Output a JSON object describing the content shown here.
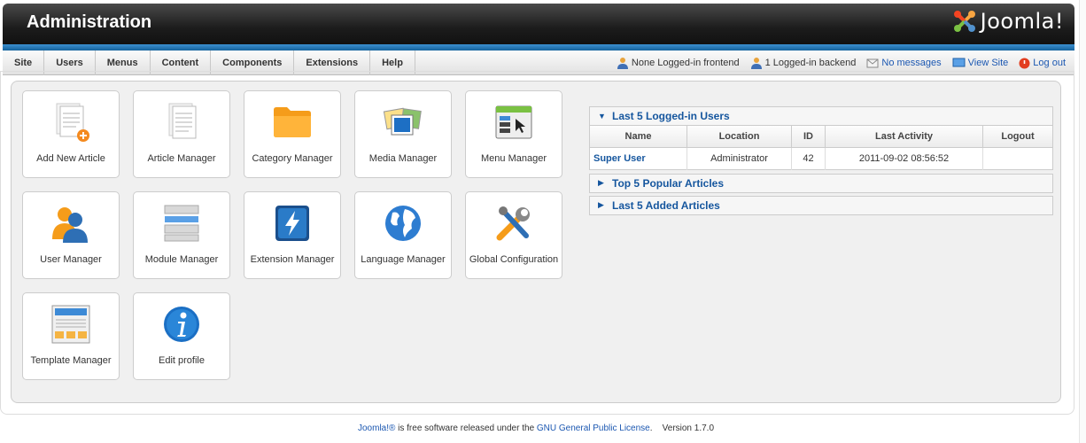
{
  "header": {
    "title": "Administration",
    "logo_text": "Joomla!"
  },
  "menu": [
    "Site",
    "Users",
    "Menus",
    "Content",
    "Components",
    "Extensions",
    "Help"
  ],
  "status": {
    "frontend": "None Logged-in frontend",
    "backend": "1 Logged-in backend",
    "messages": "No messages",
    "view_site": "View Site",
    "logout": "Log out"
  },
  "quickicons": [
    {
      "label": "Add New Article",
      "icon": "add-article-icon"
    },
    {
      "label": "Article Manager",
      "icon": "article-icon"
    },
    {
      "label": "Category Manager",
      "icon": "folder-icon"
    },
    {
      "label": "Media Manager",
      "icon": "media-icon"
    },
    {
      "label": "Menu Manager",
      "icon": "menu-icon"
    },
    {
      "label": "User Manager",
      "icon": "users-icon"
    },
    {
      "label": "Module Manager",
      "icon": "module-icon"
    },
    {
      "label": "Extension Manager",
      "icon": "extension-icon"
    },
    {
      "label": "Language Manager",
      "icon": "globe-icon"
    },
    {
      "label": "Global Configuration",
      "icon": "tools-icon"
    },
    {
      "label": "Template Manager",
      "icon": "template-icon"
    },
    {
      "label": "Edit profile",
      "icon": "info-icon"
    }
  ],
  "panels": {
    "logged": {
      "title": "Last 5 Logged-in Users",
      "columns": [
        "Name",
        "Location",
        "ID",
        "Last Activity",
        "Logout"
      ],
      "rows": [
        [
          "Super User",
          "Administrator",
          "42",
          "2011-09-02 08:56:52",
          ""
        ]
      ]
    },
    "popular": "Top 5 Popular Articles",
    "added": "Last 5 Added Articles"
  },
  "footer": {
    "brand": "Joomla!®",
    "text1": " is free software released under the ",
    "license": "GNU General Public License",
    "version": ".    Version 1.7.0"
  },
  "colors": {
    "accent": "#15569e",
    "bluebar": "#2a78bb",
    "header": "#1c1c1c",
    "folder": "#ffa726"
  }
}
